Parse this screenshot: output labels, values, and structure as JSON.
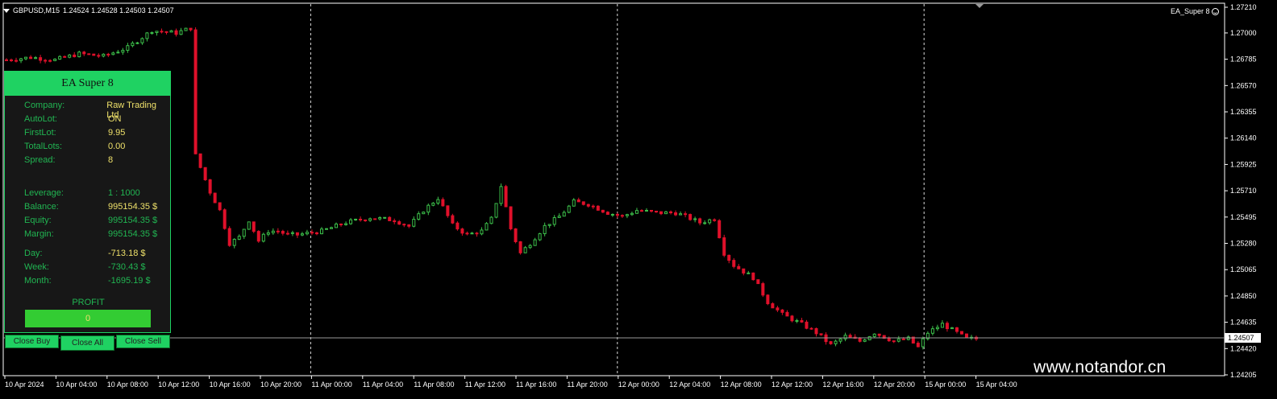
{
  "header": {
    "symbol": "GBPUSD,M15",
    "ohlc": "1.24524 1.24528 1.24503 1.24507"
  },
  "indicator_label": "EA_Super 8",
  "watermark": "www.notandor.cn",
  "colors": {
    "background": "#000000",
    "bull_candle": "#3cbf4a",
    "bear_candle": "#e0102a",
    "panel_accent": "#1fd262",
    "value_yellow": "#eee06a"
  },
  "price_axis": {
    "ticks": [
      "1.27210",
      "1.27000",
      "1.26785",
      "1.26570",
      "1.26355",
      "1.26140",
      "1.25925",
      "1.25710",
      "1.25495",
      "1.25280",
      "1.25065",
      "1.24850",
      "1.24635",
      "1.24420",
      "1.24205"
    ],
    "current_price": "1.24507"
  },
  "time_axis": {
    "labels": [
      "10 Apr 2024",
      "10 Apr 04:00",
      "10 Apr 08:00",
      "10 Apr 12:00",
      "10 Apr 16:00",
      "10 Apr 20:00",
      "11 Apr 00:00",
      "11 Apr 04:00",
      "11 Apr 08:00",
      "11 Apr 12:00",
      "11 Apr 16:00",
      "11 Apr 20:00",
      "12 Apr 00:00",
      "12 Apr 04:00",
      "12 Apr 08:00",
      "12 Apr 12:00",
      "12 Apr 16:00",
      "12 Apr 20:00",
      "15 Apr 00:00",
      "15 Apr 04:00"
    ],
    "day_separators": [
      "11 Apr 00:00",
      "12 Apr 00:00",
      "15 Apr 00:00"
    ]
  },
  "chart_data": {
    "type": "candlestick",
    "symbol": "GBPUSD",
    "timeframe": "M15",
    "ylim": [
      1.24205,
      1.2721
    ],
    "close_path": [
      [
        0,
        1.2678
      ],
      [
        5,
        1.268
      ],
      [
        10,
        1.2678
      ],
      [
        15,
        1.2683
      ],
      [
        20,
        1.2681
      ],
      [
        25,
        1.2688
      ],
      [
        30,
        1.2702
      ],
      [
        35,
        1.27
      ],
      [
        38,
        1.2704
      ],
      [
        39,
        1.26
      ],
      [
        40,
        1.259
      ],
      [
        42,
        1.257
      ],
      [
        44,
        1.2555
      ],
      [
        46,
        1.2528
      ],
      [
        48,
        1.2533
      ],
      [
        50,
        1.2547
      ],
      [
        52,
        1.253
      ],
      [
        54,
        1.2538
      ],
      [
        56,
        1.2538
      ],
      [
        58,
        1.2535
      ],
      [
        60,
        1.2535
      ],
      [
        65,
        1.2538
      ],
      [
        70,
        1.2545
      ],
      [
        75,
        1.2549
      ],
      [
        80,
        1.2547
      ],
      [
        83,
        1.2542
      ],
      [
        86,
        1.2555
      ],
      [
        89,
        1.2565
      ],
      [
        92,
        1.2543
      ],
      [
        95,
        1.2535
      ],
      [
        98,
        1.2538
      ],
      [
        100,
        1.2548
      ],
      [
        102,
        1.2575
      ],
      [
        104,
        1.254
      ],
      [
        106,
        1.252
      ],
      [
        108,
        1.2528
      ],
      [
        111,
        1.2542
      ],
      [
        114,
        1.255
      ],
      [
        117,
        1.2562
      ],
      [
        120,
        1.256
      ],
      [
        124,
        1.2553
      ],
      [
        127,
        1.255
      ],
      [
        130,
        1.2555
      ],
      [
        134,
        1.2553
      ],
      [
        138,
        1.2553
      ],
      [
        140,
        1.255
      ],
      [
        143,
        1.2545
      ],
      [
        146,
        1.2548
      ],
      [
        148,
        1.252
      ],
      [
        150,
        1.251
      ],
      [
        154,
        1.25
      ],
      [
        157,
        1.248
      ],
      [
        160,
        1.247
      ],
      [
        164,
        1.2462
      ],
      [
        167,
        1.2455
      ],
      [
        170,
        1.2445
      ],
      [
        173,
        1.2452
      ],
      [
        176,
        1.2448
      ],
      [
        179,
        1.2455
      ],
      [
        183,
        1.2448
      ],
      [
        186,
        1.245
      ],
      [
        188,
        1.2443
      ],
      [
        190,
        1.2455
      ],
      [
        193,
        1.2462
      ],
      [
        196,
        1.2455
      ],
      [
        198,
        1.245
      ]
    ]
  },
  "panel": {
    "title": "EA Super 8",
    "rows": [
      {
        "label": "Company:",
        "value": "Raw Trading Ltd"
      },
      {
        "label": "AutoLot:",
        "value": "ON"
      },
      {
        "label": "FirstLot:",
        "value": "9.95"
      },
      {
        "label": "TotalLots:",
        "value": "0.00"
      },
      {
        "label": "Spread:",
        "value": "8"
      },
      {
        "label": "Leverage:",
        "value": "1 : 1000"
      },
      {
        "label": "Balance:",
        "value": "995154.35 $"
      },
      {
        "label": "Equity:",
        "value": "995154.35 $"
      },
      {
        "label": "Margin:",
        "value": "995154.35 $"
      },
      {
        "label": "Day:",
        "value": "-713.18 $"
      },
      {
        "label": "Week:",
        "value": "-730.43 $"
      },
      {
        "label": "Month:",
        "value": "-1695.19 $"
      }
    ],
    "profit_label": "PROFIT",
    "profit_value": "0"
  },
  "buttons": {
    "close_buy": "Close Buy",
    "close_all": "Close All",
    "close_sell": "Close Sell"
  }
}
